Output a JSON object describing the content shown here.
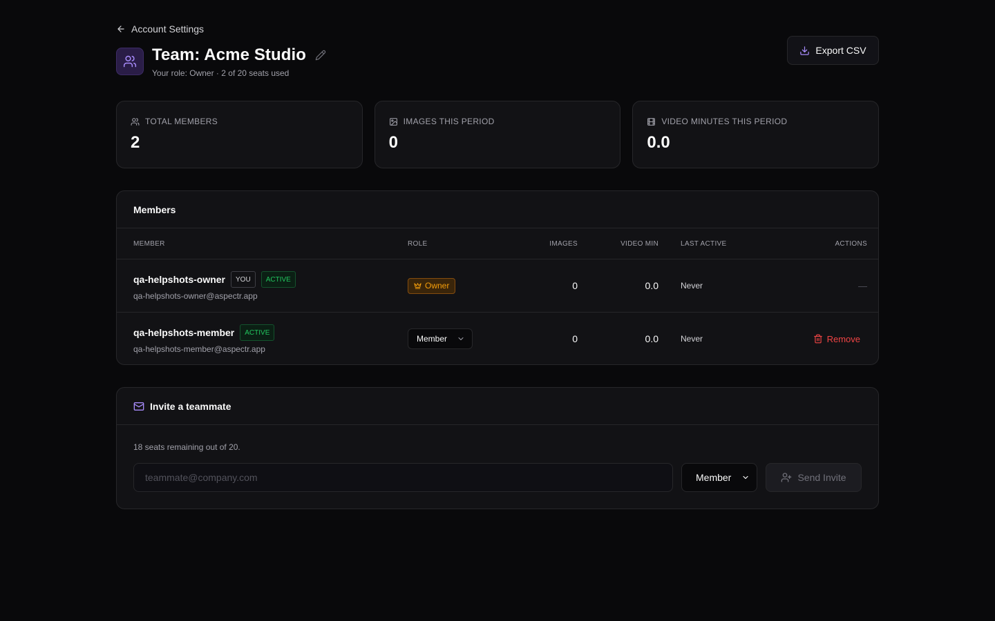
{
  "nav": {
    "back_label": "Account Settings"
  },
  "header": {
    "title": "Team: Acme Studio",
    "subtitle": "Your role: Owner · 2 of 20 seats used",
    "export_label": "Export CSV"
  },
  "stats": [
    {
      "label": "TOTAL MEMBERS",
      "value": "2",
      "icon": "users-icon"
    },
    {
      "label": "IMAGES THIS PERIOD",
      "value": "0",
      "icon": "image-icon"
    },
    {
      "label": "VIDEO MINUTES THIS PERIOD",
      "value": "0.0",
      "icon": "film-icon"
    }
  ],
  "members": {
    "title": "Members",
    "columns": [
      "MEMBER",
      "ROLE",
      "IMAGES",
      "VIDEO MIN",
      "LAST ACTIVE",
      "ACTIONS"
    ],
    "rows": [
      {
        "name": "qa-helpshots-owner",
        "you_badge": "YOU",
        "status": "ACTIVE",
        "email": "qa-helpshots-owner@aspectr.app",
        "role": "Owner",
        "images": "0",
        "video_min": "0.0",
        "last_active": "Never",
        "action": "—"
      },
      {
        "name": "qa-helpshots-member",
        "status": "ACTIVE",
        "email": "qa-helpshots-member@aspectr.app",
        "role": "Member",
        "images": "0",
        "video_min": "0.0",
        "last_active": "Never",
        "action": "Remove"
      }
    ]
  },
  "invite": {
    "title": "Invite a teammate",
    "seats_text": "18 seats remaining out of 20.",
    "email_placeholder": "teammate@company.com",
    "role_value": "Member",
    "send_label": "Send Invite"
  },
  "colors": {
    "background": "#09090b",
    "accent_purple": "#a78bfa",
    "active_green": "#22c55e",
    "owner_amber": "#f59e0b",
    "danger_red": "#ef4444"
  }
}
